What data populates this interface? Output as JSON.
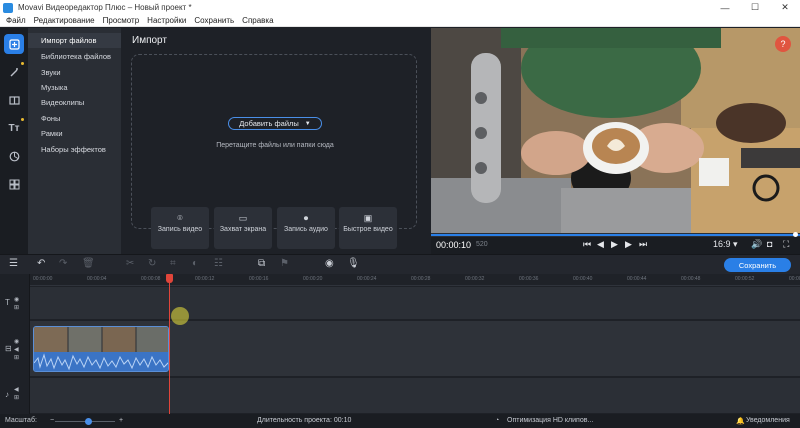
{
  "window": {
    "title": "Movavi Видеоредактор Плюс – Новый проект *",
    "min": "—",
    "max": "☐",
    "close": "✕"
  },
  "menu": [
    "Файл",
    "Редактирование",
    "Просмотр",
    "Настройки",
    "Сохранить",
    "Справка"
  ],
  "rail": [
    "import-icon",
    "filters-icon",
    "transitions-icon",
    "titles-icon",
    "stickers-icon",
    "more-tools-icon"
  ],
  "categories": [
    "Импорт файлов",
    "Библиотека файлов",
    "Звуки",
    "Музыка",
    "Видеоклипы",
    "Фоны",
    "Рамки",
    "Наборы эффектов"
  ],
  "import": {
    "title": "Импорт",
    "add_files": "Добавить файлы",
    "hint": "Перетащите файлы или папки сюда",
    "buttons": [
      "Запись видео",
      "Захват экрана",
      "Запись аудио",
      "Быстрое видео"
    ]
  },
  "player": {
    "timecode": "00:00:10",
    "timecode_ms": "520",
    "aspect": "16:9 ▾",
    "progress": 1.0
  },
  "toolbar": {
    "export_label": "Сохранить"
  },
  "ruler": [
    "00:00:00",
    "00:00:04",
    "00:00:08",
    "00:00:12",
    "00:00:16",
    "00:00:20",
    "00:00:24",
    "00:00:28",
    "00:00:32",
    "00:00:36",
    "00:00:40",
    "00:00:44",
    "00:00:48",
    "00:00:52",
    "00:00:56"
  ],
  "status": {
    "scale_label": "Масштаб:",
    "duration": "Длительность проекта: 00:10",
    "hd_optimization": "Оптимизация HD клипов...",
    "notifications": "Уведомления"
  }
}
